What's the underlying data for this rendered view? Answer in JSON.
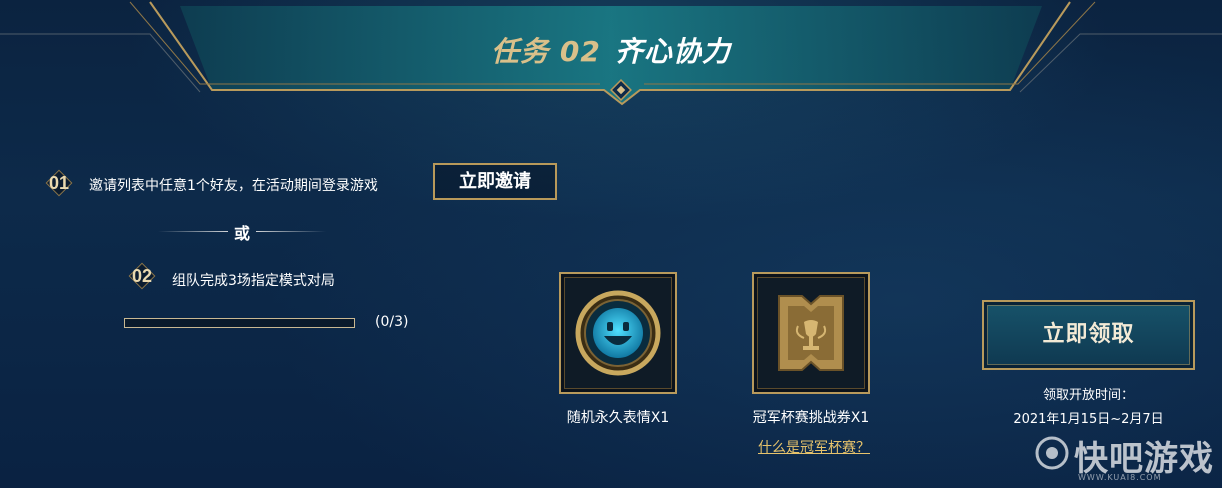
{
  "banner": {
    "number": "任务 02",
    "title": "齐心协力"
  },
  "task1": {
    "badge": "01",
    "text": "邀请列表中任意1个好友，在活动期间登录游戏",
    "button_label": "立即邀请"
  },
  "divider": {
    "label": "或"
  },
  "task2": {
    "badge": "02",
    "text": "组队完成3场指定模式对局",
    "progress_text": "(0/3)",
    "progress_fraction": 0
  },
  "rewards": [
    {
      "name": "随机永久表情X1",
      "icon": "smiley-emote-icon"
    },
    {
      "name": "冠军杯赛挑战券X1",
      "icon": "trophy-ticket-icon"
    }
  ],
  "rewards_link": "什么是冠军杯赛？",
  "claim": {
    "button_label": "立即领取",
    "time_label": "领取开放时间：",
    "time_range": "2021年1月15日~2月7日"
  },
  "watermark": {
    "name": "快吧游戏",
    "url": "WWW.KUAI8.COM"
  },
  "colors": {
    "gold": "#b89a5c",
    "accent_teal": "#17536a",
    "link_gold": "#e7c36b",
    "background": "#0d2a4a"
  }
}
